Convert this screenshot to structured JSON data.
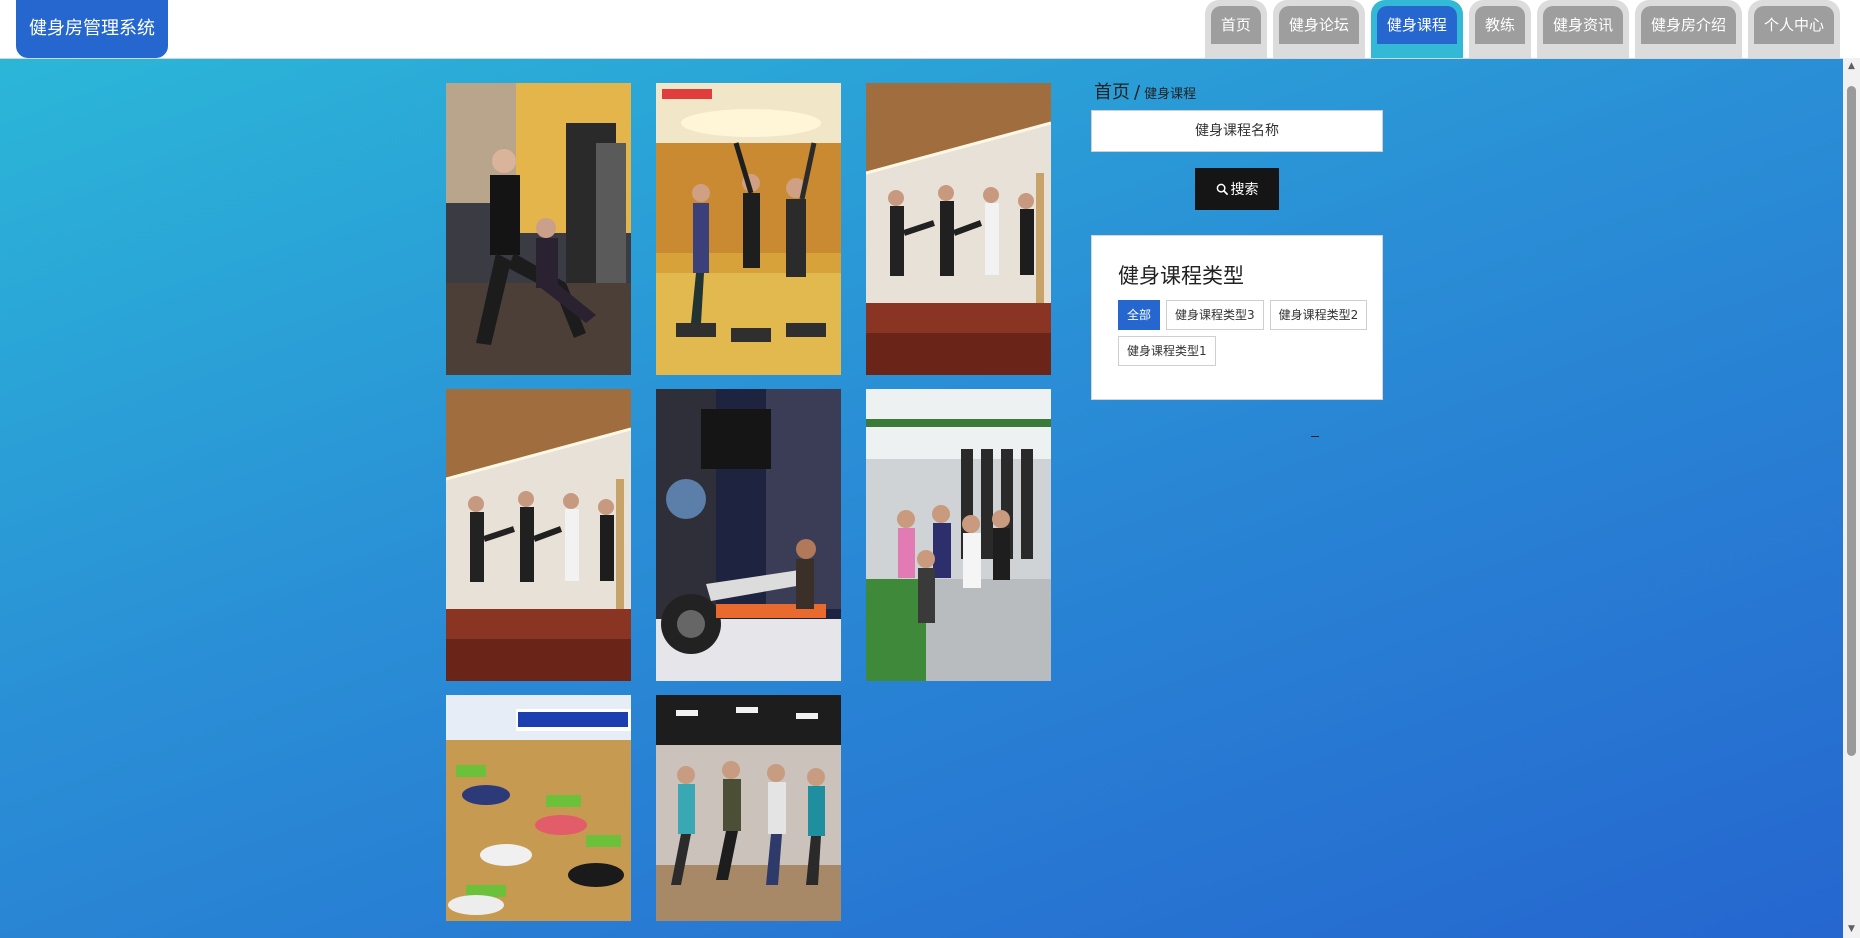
{
  "app": {
    "title": "健身房管理系统"
  },
  "nav": {
    "items": [
      {
        "label": "首页",
        "active": false
      },
      {
        "label": "健身论坛",
        "active": false
      },
      {
        "label": "健身课程",
        "active": true
      },
      {
        "label": "教练",
        "active": false
      },
      {
        "label": "健身资讯",
        "active": false
      },
      {
        "label": "健身房介绍",
        "active": false
      },
      {
        "label": "个人中心",
        "active": false
      }
    ]
  },
  "breadcrumb": {
    "home": "首页",
    "separator": "/",
    "current": "健身课程"
  },
  "search": {
    "placeholder": "健身课程名称",
    "button_label": "搜索",
    "icon": "search-icon"
  },
  "category_panel": {
    "title": "健身课程类型",
    "filters": [
      {
        "label": "全部",
        "active": true
      },
      {
        "label": "健身课程类型3",
        "active": false
      },
      {
        "label": "健身课程类型2",
        "active": false
      },
      {
        "label": "健身课程类型1",
        "active": false
      }
    ]
  },
  "courses": [
    {
      "scene": "trainer-lunge-stretch"
    },
    {
      "scene": "step-aerobics-class"
    },
    {
      "scene": "kickboxing-class-wood-floor"
    },
    {
      "scene": "kickboxing-class-wood-floor"
    },
    {
      "scene": "treadmill-stretch-pose"
    },
    {
      "scene": "group-circle-treadmills"
    },
    {
      "scene": "red-club-floor-workout"
    },
    {
      "scene": "dance-fitness-group"
    }
  ],
  "colors": {
    "accent": "#2667cf",
    "active_tab_outline": "#33b9d6",
    "inactive_tab": "#9e9e9e",
    "background_start": "#2bbad8",
    "background_end": "#2566cf",
    "search_button": "#151515"
  }
}
